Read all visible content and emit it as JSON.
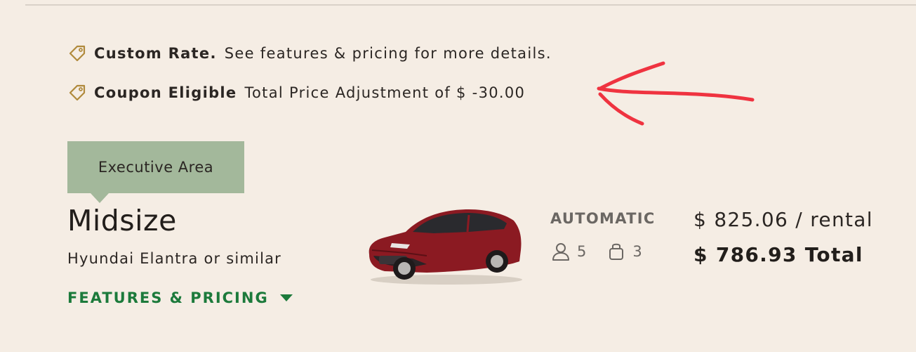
{
  "promotions": [
    {
      "icon": "tag-icon",
      "strong": "Custom Rate.",
      "text": "See features & pricing for more details."
    },
    {
      "icon": "tag-icon",
      "strong": "Coupon Eligible",
      "text": "Total Price Adjustment of $ -30.00"
    }
  ],
  "annotation": {
    "icon": "hand-drawn-arrow",
    "color": "#ef3340"
  },
  "vehicle": {
    "location_badge": "Executive Area",
    "class_name": "Midsize",
    "model": "Hyundai Elantra or similar",
    "features_link": "FEATURES & PRICING",
    "features_link_icon": "caret-down-icon",
    "transmission": "AUTOMATIC",
    "passengers": "5",
    "passengers_icon": "person-icon",
    "bags": "3",
    "bags_icon": "bag-icon",
    "rate": "$ 825.06 / rental",
    "total": "$ 786.93 Total",
    "car_color": "#8b1a22"
  },
  "colors": {
    "background": "#f5ede4",
    "badge": "#a3b89b",
    "link": "#1c7a3b",
    "tag_icon": "#b08a3c"
  }
}
